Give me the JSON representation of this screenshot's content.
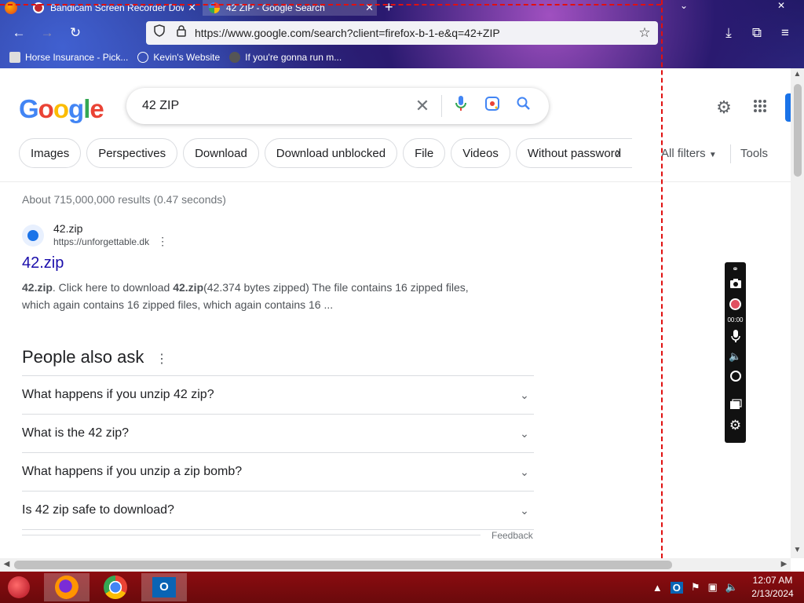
{
  "browser": {
    "tabs": [
      {
        "title": "Bandicam Screen Recorder Dow",
        "close": "✕",
        "active": false
      },
      {
        "title": "42 ZIP - Google Search",
        "close": "✕",
        "active": true
      }
    ],
    "new_tab": "+",
    "url": "https://www.google.com/search?client=firefox-b-1-e&q=42+ZIP",
    "bookmarks": [
      "Horse Insurance - Pick...",
      "Kevin's Website",
      "If you're gonna run m..."
    ]
  },
  "google": {
    "logo_letters": [
      {
        "ch": "G",
        "color": "#4285F4"
      },
      {
        "ch": "o",
        "color": "#EA4335"
      },
      {
        "ch": "o",
        "color": "#FBBC05"
      },
      {
        "ch": "g",
        "color": "#4285F4"
      },
      {
        "ch": "l",
        "color": "#34A853"
      },
      {
        "ch": "e",
        "color": "#EA4335"
      }
    ],
    "query": "42 ZIP",
    "chips": [
      "Images",
      "Perspectives",
      "Download",
      "Download unblocked",
      "File",
      "Videos",
      "Without password"
    ],
    "all_filters": "All filters",
    "tools": "Tools",
    "stats": "About 715,000,000 results (0.47 seconds)",
    "result": {
      "site_name": "42.zip",
      "site_url": "https://unforgettable.dk",
      "title": "42.zip",
      "snippet_parts": [
        {
          "text": "42.zip",
          "bold": true
        },
        {
          "text": ". Click here to download ",
          "bold": false
        },
        {
          "text": "42.zip",
          "bold": true
        },
        {
          "text": "(42.374 bytes zipped) The file contains 16 zipped files, which again contains 16 zipped files, which again contains 16 ...",
          "bold": false
        }
      ]
    },
    "paa_title": "People also ask",
    "paa_questions": [
      "What happens if you unzip 42 zip?",
      "What is the 42 zip?",
      "What happens if you unzip a zip bomb?",
      "Is 42 zip safe to download?"
    ],
    "feedback": "Feedback"
  },
  "recorder": {
    "timer": "00:00"
  },
  "taskbar": {
    "time": "12:07 AM",
    "date": "2/13/2024"
  },
  "colors": {
    "link": "#1a0dab",
    "accent_blue": "#1a73e8",
    "recorder_line": "#e01010",
    "taskbar": "#8c0c10"
  }
}
